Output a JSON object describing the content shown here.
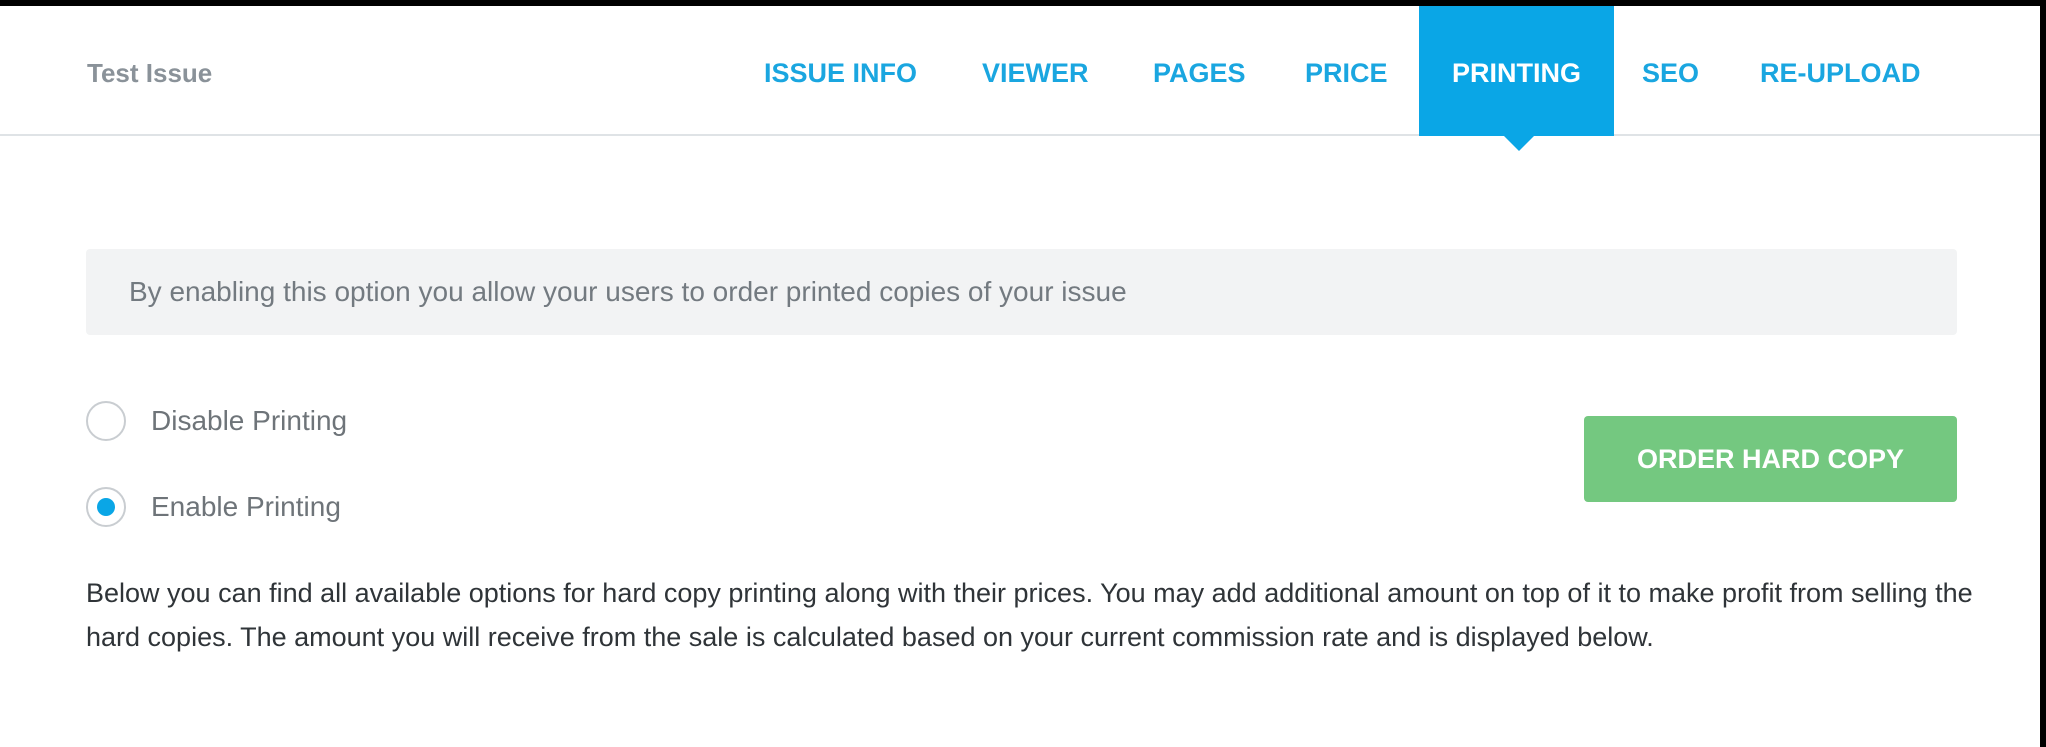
{
  "header": {
    "issue_title": "Test Issue",
    "tabs": [
      {
        "label": "ISSUE INFO",
        "active": false
      },
      {
        "label": "VIEWER",
        "active": false
      },
      {
        "label": "PAGES",
        "active": false
      },
      {
        "label": "PRICE",
        "active": false
      },
      {
        "label": "PRINTING",
        "active": true
      },
      {
        "label": "SEO",
        "active": false
      },
      {
        "label": "RE-UPLOAD",
        "active": false
      }
    ]
  },
  "printing": {
    "info_text": "By enabling this option you allow your users to order printed copies of your issue",
    "options": [
      {
        "label": "Disable Printing",
        "selected": false
      },
      {
        "label": "Enable Printing",
        "selected": true
      }
    ],
    "order_button_label": "ORDER HARD COPY",
    "description": "Below you can find all available options for hard copy printing along with their prices. You may add additional amount on top of it to make profit from selling the hard copies. The amount you will receive from the sale is calculated based on your current commission rate and is displayed below."
  },
  "colors": {
    "accent": "#0aa6e6",
    "tab_text": "#1aa6e0",
    "button_green": "#74c880",
    "info_box_bg": "#f2f3f4"
  }
}
